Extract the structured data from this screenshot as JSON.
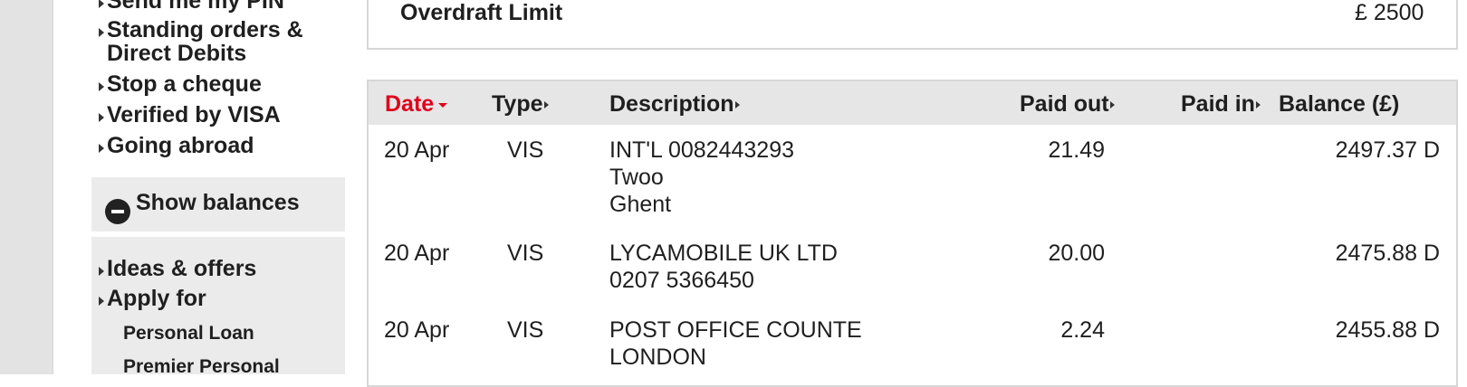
{
  "sidebar": {
    "links": [
      "Send me my PIN",
      "Standing orders &\nDirect Debits",
      "Stop a cheque",
      "Verified by VISA",
      "Going abroad"
    ],
    "show_balances": "Show balances",
    "lower_links": [
      "Ideas & offers",
      "Apply for"
    ],
    "sub_links": [
      "Personal Loan",
      "Premier Personal"
    ]
  },
  "overdraft": {
    "label": "Overdraft Limit",
    "value": "£ 2500"
  },
  "table": {
    "headers": {
      "date": "Date",
      "type": "Type",
      "description": "Description",
      "paid_out": "Paid out",
      "paid_in": "Paid in",
      "balance": "Balance (£)"
    },
    "rows": [
      {
        "date": "20 Apr",
        "type": "VIS",
        "description": [
          "INT'L 0082443293",
          "Twoo",
          "Ghent"
        ],
        "paid_out": "21.49",
        "paid_in": "",
        "balance": "2497.37 D"
      },
      {
        "date": "20 Apr",
        "type": "VIS",
        "description": [
          "LYCAMOBILE UK LTD",
          "0207 5366450"
        ],
        "paid_out": "20.00",
        "paid_in": "",
        "balance": "2475.88 D"
      },
      {
        "date": "20 Apr",
        "type": "VIS",
        "description": [
          "POST OFFICE COUNTE",
          "LONDON"
        ],
        "paid_out": "2.24",
        "paid_in": "",
        "balance": "2455.88 D"
      }
    ]
  }
}
